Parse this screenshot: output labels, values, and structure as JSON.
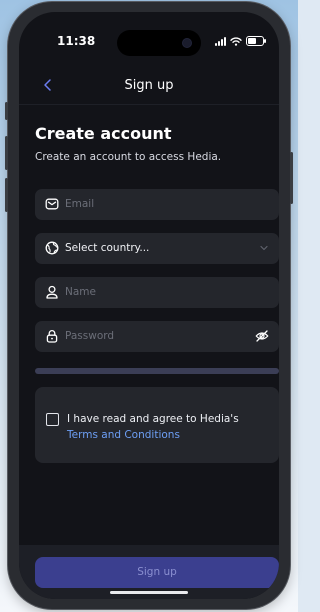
{
  "status": {
    "time": "11:38"
  },
  "nav": {
    "title": "Sign up"
  },
  "header": {
    "title": "Create account",
    "subtitle": "Create an account to access Hedia."
  },
  "form": {
    "email_placeholder": "Email",
    "country_value": "Select country...",
    "name_placeholder": "Name",
    "password_placeholder": "Password",
    "password_strength": 0
  },
  "terms": {
    "checked": false,
    "text": "I have read and agree to Hedia's",
    "link": "Terms and Conditions"
  },
  "actions": {
    "signup_label": "Sign up"
  },
  "icons": {
    "back": "chevron-left-icon",
    "email": "envelope-icon",
    "country": "globe-icon",
    "name": "person-icon",
    "password": "lock-icon",
    "visibility": "eye-off-icon",
    "dropdown": "chevron-down-icon"
  },
  "colors": {
    "screen_bg": "#121318",
    "field_bg": "#24262c",
    "accent": "#3b3f8f",
    "link": "#6d9ff5",
    "back_icon": "#6b7cf0"
  }
}
